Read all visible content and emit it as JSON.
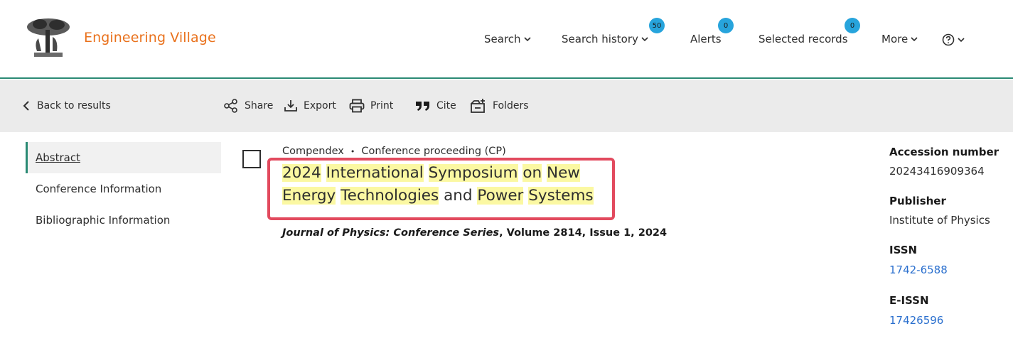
{
  "header": {
    "brand": "Engineering Village",
    "nav": {
      "search": "Search",
      "search_history": "Search history",
      "search_history_badge": "50",
      "alerts": "Alerts",
      "alerts_badge": "0",
      "selected_records": "Selected records",
      "selected_records_badge": "0",
      "more": "More"
    }
  },
  "toolbar": {
    "back": "Back to results",
    "share": "Share",
    "export": "Export",
    "print": "Print",
    "cite": "Cite",
    "folders": "Folders"
  },
  "sidebar": {
    "items": [
      {
        "label": "Abstract"
      },
      {
        "label": "Conference Information"
      },
      {
        "label": "Bibliographic Information"
      }
    ]
  },
  "record": {
    "database": "Compendex",
    "separator": "•",
    "doc_type": "Conference proceeding (CP)",
    "title_words": [
      "2024",
      "International",
      "Symposium",
      "on",
      "New",
      "Energy",
      "Technologies",
      "and",
      "Power",
      "Systems"
    ],
    "source_journal": "Journal of Physics: Conference Series",
    "source_details": ", Volume 2814, Issue 1, 2024"
  },
  "details": {
    "accession_label": "Accession number",
    "accession_value": "20243416909364",
    "publisher_label": "Publisher",
    "publisher_value": "Institute of Physics",
    "issn_label": "ISSN",
    "issn_value": "1742-6588",
    "eissn_label": "E-ISSN",
    "eissn_value": "17426596"
  },
  "colors": {
    "brand": "#e9711c",
    "accent": "#2a8a74",
    "badge": "#27a4dc",
    "highlight": "#fbf8a2",
    "focus_box": "#e24a5e",
    "link": "#2a6fce"
  }
}
